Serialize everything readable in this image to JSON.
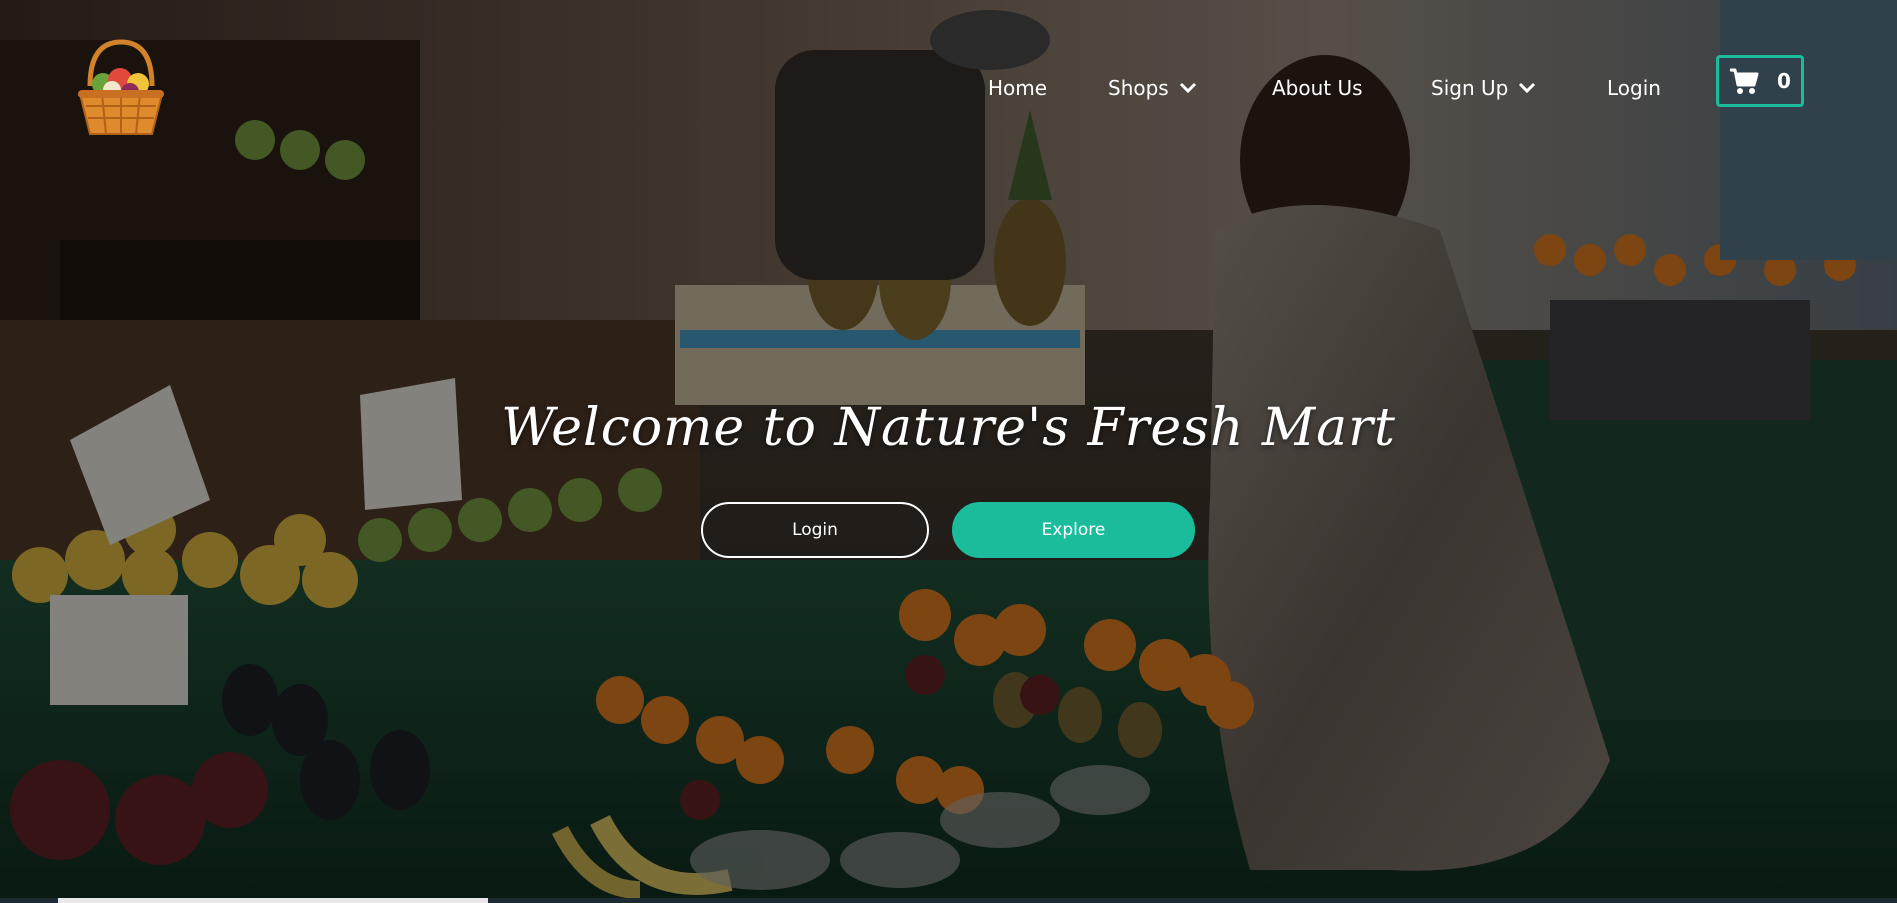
{
  "brand": {
    "logo_icon": "fruit-basket-icon"
  },
  "nav": {
    "items": [
      {
        "label": "Home",
        "has_dropdown": false
      },
      {
        "label": "Shops",
        "has_dropdown": true
      },
      {
        "label": "About Us",
        "has_dropdown": false
      },
      {
        "label": "Sign Up",
        "has_dropdown": true
      },
      {
        "label": "Login",
        "has_dropdown": false
      }
    ],
    "cart": {
      "icon": "shopping-cart-icon",
      "count": "0"
    }
  },
  "hero": {
    "headline": "Welcome to Nature's Fresh Mart",
    "login_button": "Login",
    "explore_button": "Explore",
    "background_image": "market-fruit-stall-photo"
  },
  "colors": {
    "accent": "#1bbc9b",
    "text": "#ffffff"
  }
}
